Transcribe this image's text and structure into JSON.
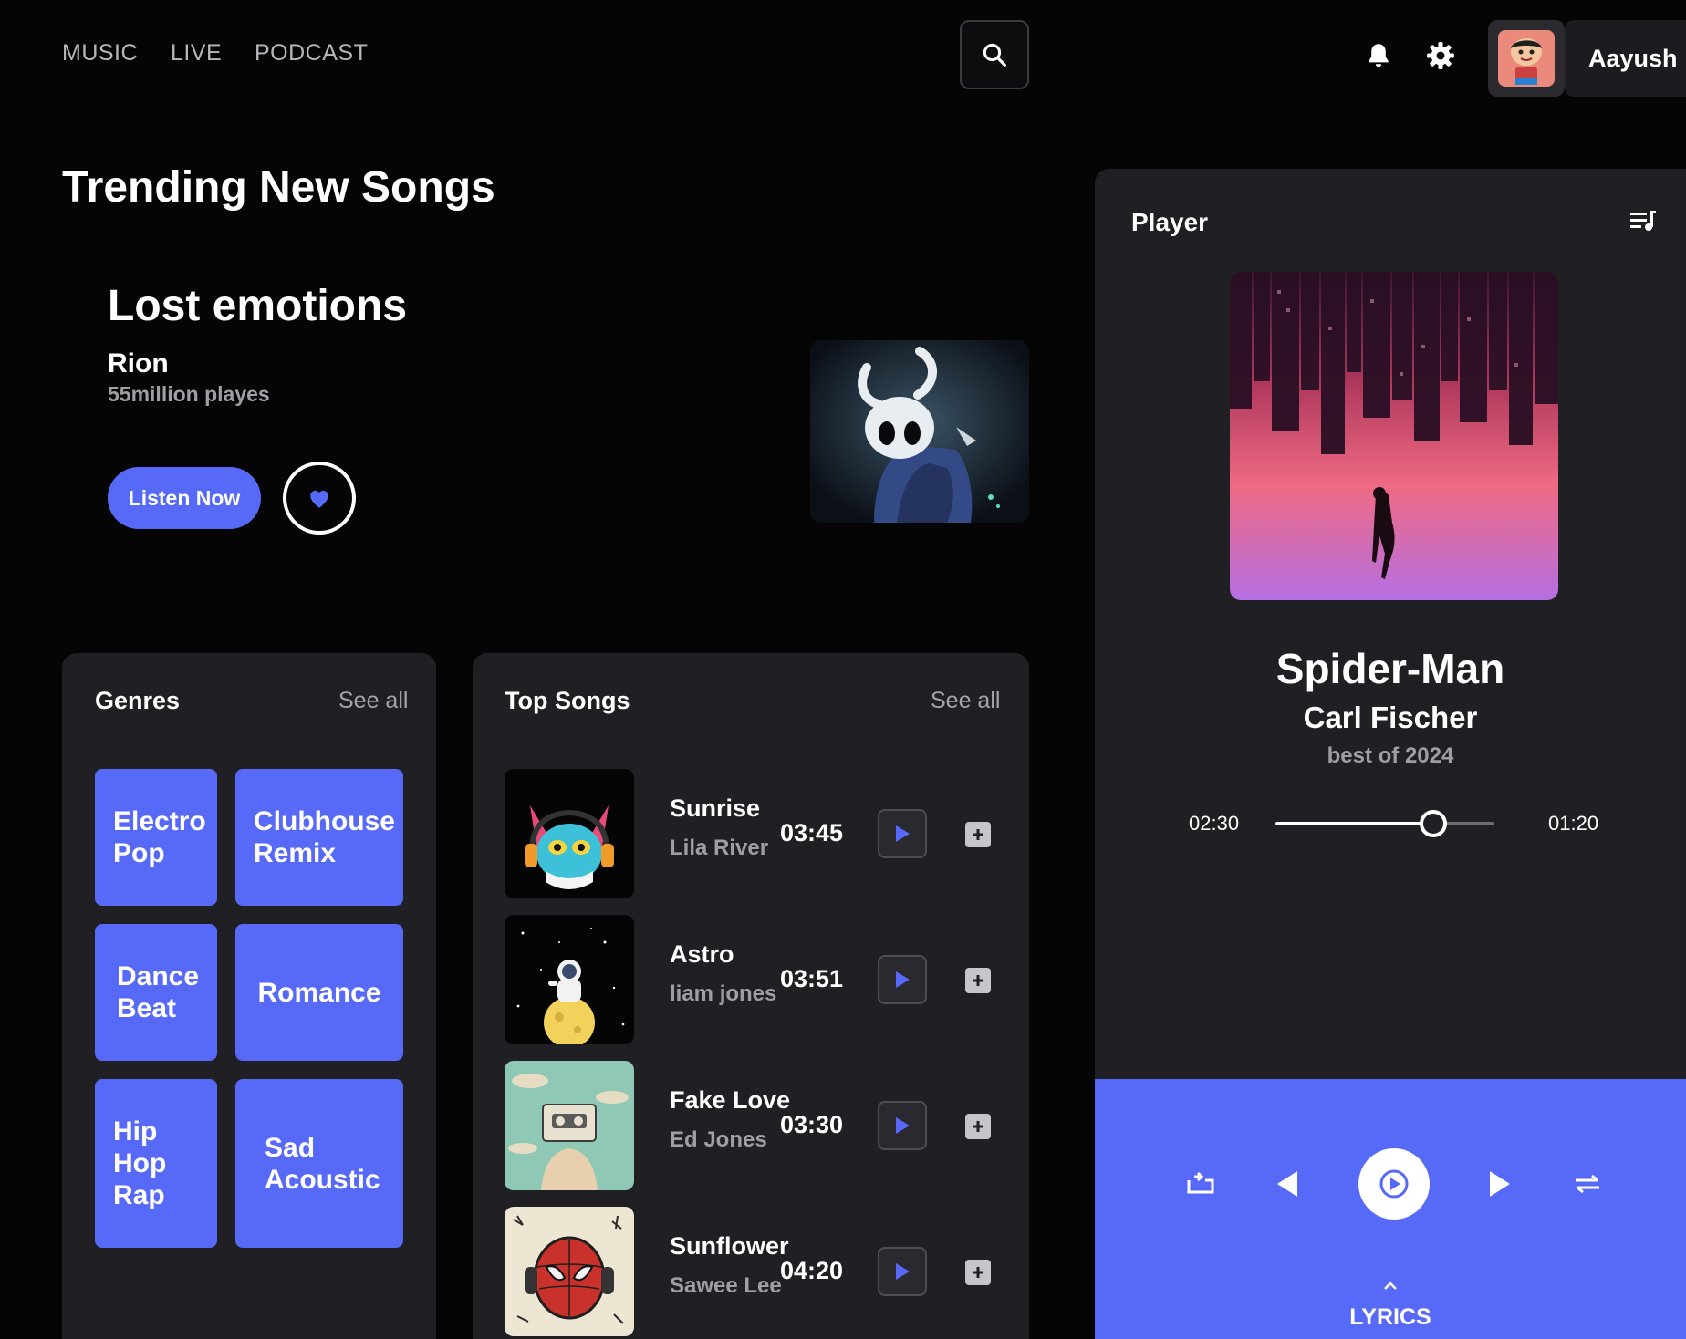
{
  "nav": {
    "music": "MUSIC",
    "live": "LIVE",
    "podcast": "PODCAST"
  },
  "user": {
    "name": "Aayush"
  },
  "section": {
    "title": "Trending New Songs"
  },
  "hero": {
    "title": "Lost emotions",
    "artist": "Rion",
    "plays": "55million playes",
    "listen_label": "Listen Now"
  },
  "genres": {
    "title": "Genres",
    "see_all": "See all",
    "items": [
      "Electro\nPop",
      "Clubhouse\nRemix",
      "Dance\nBeat",
      "Romance",
      "Hip\nHop\nRap",
      "Sad\nAcoustic"
    ]
  },
  "top_songs": {
    "title": "Top Songs",
    "see_all": "See all",
    "items": [
      {
        "title": "Sunrise",
        "artist": "Lila River",
        "duration": "03:45"
      },
      {
        "title": "Astro",
        "artist": "liam jones",
        "duration": "03:51"
      },
      {
        "title": "Fake Love",
        "artist": "Ed Jones",
        "duration": "03:30"
      },
      {
        "title": "Sunflower",
        "artist": "Sawee Lee",
        "duration": "04:20"
      }
    ]
  },
  "player": {
    "title": "Player",
    "song": "Spider-Man",
    "artist": "Carl Fischer",
    "album": "best of 2024",
    "elapsed": "02:30",
    "remaining": "01:20",
    "progress": 0.72,
    "lyrics_label": "LYRICS"
  },
  "colors": {
    "accent": "#5769f7",
    "background": "#050506",
    "panel": "#202024",
    "muted": "#9e9ea4"
  }
}
